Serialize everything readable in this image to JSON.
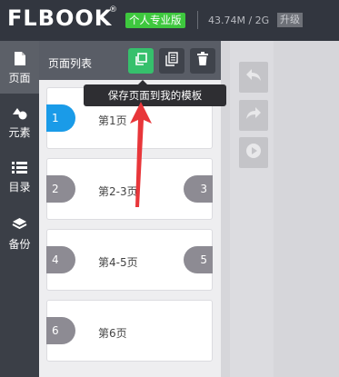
{
  "header": {
    "logo": "FLBOOK",
    "logo_reg": "®",
    "plan_badge": "个人专业版",
    "storage": "43.74M / 2G",
    "upgrade_label": "升级"
  },
  "nav": {
    "items": [
      {
        "label": "页面",
        "icon": "page-icon",
        "active": true
      },
      {
        "label": "元素",
        "icon": "shapes-icon",
        "active": false
      },
      {
        "label": "目录",
        "icon": "list-icon",
        "active": false
      },
      {
        "label": "备份",
        "icon": "layers-icon",
        "active": false
      }
    ]
  },
  "panel": {
    "title": "页面列表",
    "tools": [
      {
        "name": "save-as-template",
        "icon": "copy-icon"
      },
      {
        "name": "duplicate-page",
        "icon": "document-icon"
      },
      {
        "name": "delete-page",
        "icon": "trash-icon"
      }
    ],
    "tooltip": "保存页面到我的模板"
  },
  "pages": [
    {
      "label": "第1页",
      "left": "1",
      "right": ""
    },
    {
      "label": "第2-3页",
      "left": "2",
      "right": "3"
    },
    {
      "label": "第4-5页",
      "left": "4",
      "right": "5"
    },
    {
      "label": "第6页",
      "left": "6",
      "right": ""
    }
  ],
  "edit_tools": [
    {
      "name": "undo",
      "icon": "undo-icon"
    },
    {
      "name": "redo",
      "icon": "redo-icon"
    },
    {
      "name": "preview",
      "icon": "play-icon"
    }
  ],
  "colors": {
    "accent_green": "#36c06c",
    "active_blue": "#1a9be8",
    "arrow_red": "#e8363a"
  }
}
